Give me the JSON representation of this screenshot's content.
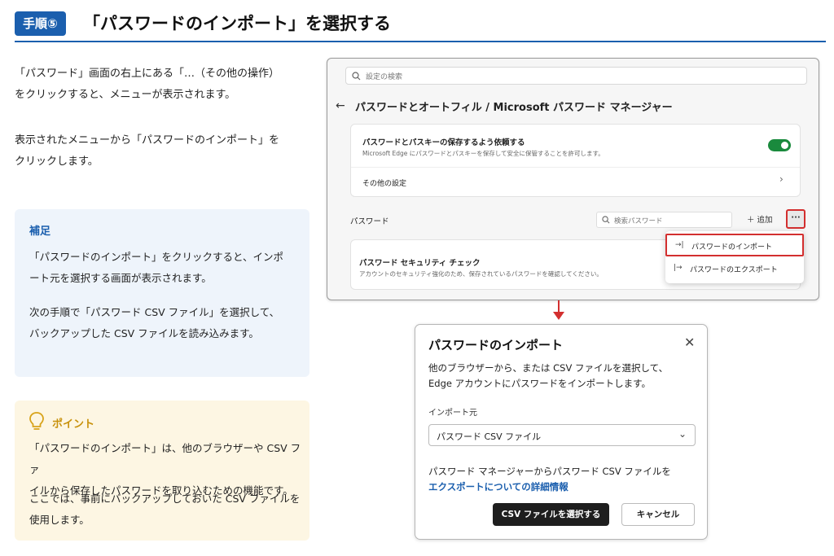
{
  "header": {
    "step_badge": "手順⑤",
    "title": "「パスワードのインポート」を選択する"
  },
  "intro": {
    "p1_line1": "「パスワード」画面の右上にある「…（その他の操作）",
    "p1_line2": "をクリックすると、メニューが表示されます。",
    "p2_line1": "表示されたメニューから「パスワードのインポート」を",
    "p2_line2": "クリックします。"
  },
  "supplement": {
    "heading": "補足",
    "line1": "「パスワードのインポート」をクリックすると、インポ",
    "line2": "ート元を選択する画面が表示されます。",
    "line3": "次の手順で「パスワード CSV ファイル」を選択して、",
    "line4": "バックアップした CSV ファイルを読み込みます。"
  },
  "point": {
    "heading": "ポイント",
    "icon": "lightbulb-icon",
    "line1": "「パスワードのインポート」は、他のブラウザーや CSV ファ",
    "line2": "イルから保存したパスワードを取り込むための機能です。",
    "line3": "ここでは、事前にバックアップしておいた CSV ファイルを",
    "line4": "使用します。"
  },
  "settings": {
    "search_placeholder": "設定の検索",
    "page_title": "パスワードとオートフィル / Microsoft パスワード マネージャー",
    "save_title": "パスワードとパスキーの保存するよう依頼する",
    "save_desc": "Microsoft Edge にパスワードとパスキーを保存して安全に保管することを許可します。",
    "other_settings": "その他の設定",
    "passwords_label": "パスワード",
    "pw_search_placeholder": "検索パスワード",
    "add_label": "追加",
    "more_label": "···",
    "security_title": "パスワード セキュリティ チェック",
    "security_desc": "アカウントのセキュリティ強化のため、保存されているパスワードを確認してください。",
    "menu": {
      "import_label": "パスワードのインポート",
      "export_label": "パスワードのエクスポート"
    }
  },
  "dialog": {
    "title": "パスワードのインポート",
    "desc_line1": "他のブラウザーから、または CSV ファイルを選択して、",
    "desc_line2": "Edge アカウントにパスワードをインポートします。",
    "source_label": "インポート元",
    "source_value": "パスワード CSV ファイル",
    "footer_text": "パスワード マネージャーからパスワード CSV ファイルを",
    "link_text": "エクスポートについての詳細情報",
    "primary_button": "CSV ファイルを選択する",
    "cancel_button": "キャンセル"
  },
  "colors": {
    "accent": "#1b5fae",
    "highlight": "#d32f2f",
    "toggle_on": "#1a8a3d"
  }
}
